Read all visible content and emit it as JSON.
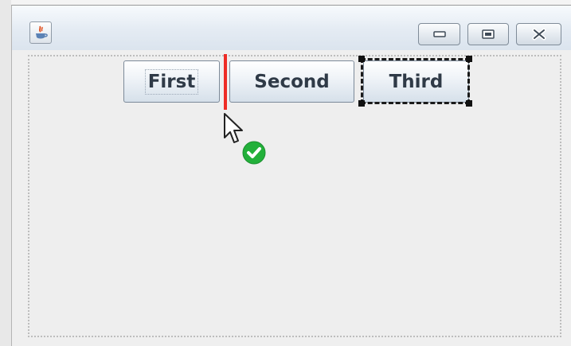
{
  "window": {
    "app_icon": "java-icon",
    "controls": {
      "minimize_icon": "minimize-icon",
      "maximize_icon": "maximize-icon",
      "close_icon": "close-icon"
    }
  },
  "buttons": [
    {
      "label": "First",
      "focused": true
    },
    {
      "label": "Second"
    },
    {
      "label": "Third",
      "selected": true
    }
  ],
  "drag": {
    "cursor_icon": "arrow-cursor-icon",
    "drop_ok_icon": "checkmark-icon",
    "indicator_color": "#ee2b24",
    "ok_color": "#22b03a"
  }
}
